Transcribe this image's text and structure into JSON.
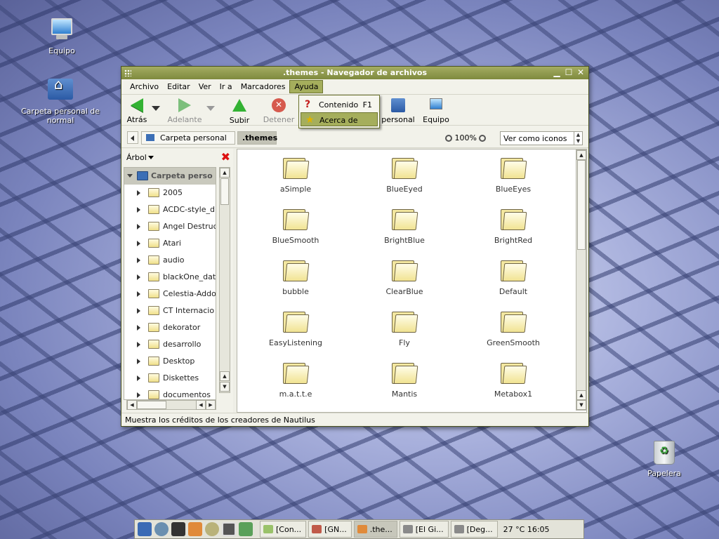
{
  "desktop": {
    "icons": [
      {
        "label": "Equipo"
      },
      {
        "label": "Carpeta personal de normal"
      },
      {
        "label": "Papelera"
      }
    ]
  },
  "window": {
    "title": ".themes - Navegador de archivos",
    "menu": [
      "Archivo",
      "Editar",
      "Ver",
      "Ir a",
      "Marcadores",
      "Ayuda"
    ],
    "toolbar": {
      "back": "Atrás",
      "forward": "Adelante",
      "up": "Subir",
      "stop": "Detener",
      "home": "personal",
      "computer": "Equipo"
    },
    "location": {
      "crumbs": [
        "Carpeta personal",
        ".themes"
      ],
      "zoom": "100%",
      "view_mode": "Ver como iconos"
    },
    "sidebar": {
      "mode": "Árbol",
      "root": "Carpeta perso",
      "items": [
        "2005",
        "ACDC-style_d",
        "Angel Destruc",
        "Atari",
        "audio",
        "blackOne_dat",
        "Celestia-Addo",
        "CT Internacio",
        "dekorator",
        "desarrollo",
        "Desktop",
        "Diskettes",
        "documentos"
      ]
    },
    "files": [
      "aSimple",
      "BlueEyed",
      "BlueEyes",
      "BlueSmooth",
      "BrightBlue",
      "BrightRed",
      "bubble",
      "ClearBlue",
      "Default",
      "EasyListening",
      "Fly",
      "GreenSmooth",
      "m.a.t.t.e",
      "Mantis",
      "Metabox1"
    ],
    "status": "Muestra los créditos de los creadores de Nautilus"
  },
  "help_menu": {
    "items": [
      {
        "label": "Contenido",
        "accel": "F1",
        "icon": "help-icon"
      },
      {
        "label": "Acerca de",
        "accel": "",
        "icon": "about-star-icon"
      }
    ]
  },
  "taskbar": {
    "tasks": [
      "[Con...",
      "[GN...",
      ".the...",
      "[El Gi...",
      "[Deg..."
    ],
    "clock": "27 °C 16:05"
  },
  "colors": {
    "titlebar": "#8f9a4c",
    "menu_highlight": "#a5ae5c"
  }
}
